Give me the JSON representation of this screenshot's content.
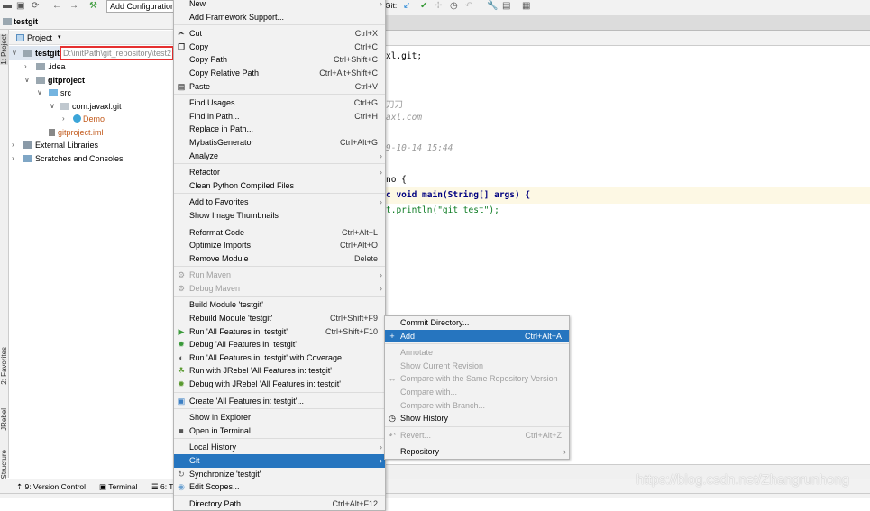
{
  "toolbar": {
    "run_config": "Add Configuration...",
    "git_label": "Git:",
    "icons": [
      "open-icon",
      "save-icon",
      "sync-icon",
      "back-icon",
      "forward-icon",
      "build-icon"
    ]
  },
  "navbar": {
    "project": "testgit"
  },
  "project_panel": {
    "title": "Project",
    "root": "testgit",
    "root_path": "D:\\initPath\\git_repository\\test2",
    "tree": [
      {
        "label": ".idea"
      },
      {
        "label": "gitproject"
      },
      {
        "label": "src"
      },
      {
        "label": "com.javaxl.git"
      },
      {
        "label": "Demo"
      },
      {
        "label": "gitproject.iml"
      },
      {
        "label": "External Libraries"
      },
      {
        "label": "Scratches and Consoles"
      }
    ]
  },
  "left_tabs": [
    "1: Project",
    "2: Favorites",
    "JRebel",
    "7: Structure"
  ],
  "code": {
    "lines": [
      "xl.git;",
      "刀刀",
      "axl.com",
      "9-10-14 15:44",
      "no {",
      "c void main(String[] args) {",
      "t.println(\"git test\");"
    ]
  },
  "bottom_tabs": [
    "9: Version Control",
    "Terminal",
    "6: T"
  ],
  "context_menu": [
    {
      "label": "New",
      "sub": true
    },
    {
      "label": "Add Framework Support..."
    },
    {
      "sep": true
    },
    {
      "label": "Cut",
      "sc": "Ctrl+X",
      "icon": "✂"
    },
    {
      "label": "Copy",
      "sc": "Ctrl+C",
      "icon": "❐"
    },
    {
      "label": "Copy Path",
      "sc": "Ctrl+Shift+C"
    },
    {
      "label": "Copy Relative Path",
      "sc": "Ctrl+Alt+Shift+C"
    },
    {
      "label": "Paste",
      "sc": "Ctrl+V",
      "icon": "▤"
    },
    {
      "sep": true
    },
    {
      "label": "Find Usages",
      "sc": "Ctrl+G"
    },
    {
      "label": "Find in Path...",
      "sc": "Ctrl+H"
    },
    {
      "label": "Replace in Path..."
    },
    {
      "label": "MybatisGenerator",
      "sc": "Ctrl+Alt+G"
    },
    {
      "label": "Analyze",
      "sub": true
    },
    {
      "sep": true
    },
    {
      "label": "Refactor",
      "sub": true
    },
    {
      "label": "Clean Python Compiled Files"
    },
    {
      "sep": true
    },
    {
      "label": "Add to Favorites",
      "sub": true
    },
    {
      "label": "Show Image Thumbnails"
    },
    {
      "sep": true
    },
    {
      "label": "Reformat Code",
      "sc": "Ctrl+Alt+L"
    },
    {
      "label": "Optimize Imports",
      "sc": "Ctrl+Alt+O"
    },
    {
      "label": "Remove Module",
      "sc": "Delete"
    },
    {
      "sep": true
    },
    {
      "label": "Run Maven",
      "sub": true,
      "dis": true,
      "icon": "⚙"
    },
    {
      "label": "Debug Maven",
      "sub": true,
      "dis": true,
      "icon": "⚙"
    },
    {
      "sep": true
    },
    {
      "label": "Build Module 'testgit'"
    },
    {
      "label": "Rebuild Module 'testgit'",
      "sc": "Ctrl+Shift+F9"
    },
    {
      "label": "Run 'All Features in: testgit'",
      "sc": "Ctrl+Shift+F10",
      "icon": "▶",
      "color": "#3a9a3a"
    },
    {
      "label": "Debug 'All Features in: testgit'",
      "icon": "✹",
      "color": "#3a9a3a"
    },
    {
      "label": "Run 'All Features in: testgit' with Coverage",
      "icon": "◐",
      "color": "#555"
    },
    {
      "label": "Run with JRebel 'All Features in: testgit'",
      "icon": "☘",
      "color": "#5a9a30"
    },
    {
      "label": "Debug with JRebel 'All Features in: testgit'",
      "icon": "✹",
      "color": "#5a9a30"
    },
    {
      "sep": true
    },
    {
      "label": "Create 'All Features in: testgit'...",
      "icon": "▣",
      "color": "#3b7fc4"
    },
    {
      "sep": true
    },
    {
      "label": "Show in Explorer"
    },
    {
      "label": "Open in Terminal",
      "icon": "■",
      "color": "#555"
    },
    {
      "sep": true
    },
    {
      "label": "Local History",
      "sub": true
    },
    {
      "label": "Git",
      "sub": true,
      "sel": true
    },
    {
      "label": "Synchronize 'testgit'",
      "icon": "↻",
      "color": "#666"
    },
    {
      "label": "Edit Scopes...",
      "icon": "◉",
      "color": "#6aa0d0"
    },
    {
      "sep": true
    },
    {
      "label": "Directory Path",
      "sc": "Ctrl+Alt+F12"
    }
  ],
  "git_submenu": [
    {
      "label": "Commit Directory..."
    },
    {
      "label": "Add",
      "sc": "Ctrl+Alt+A",
      "sel": true,
      "icon": "+"
    },
    {
      "sep": true
    },
    {
      "label": "Annotate",
      "dis": true
    },
    {
      "label": "Show Current Revision",
      "dis": true
    },
    {
      "label": "Compare with the Same Repository Version",
      "dis": true,
      "icon": "↔"
    },
    {
      "label": "Compare with...",
      "dis": true
    },
    {
      "label": "Compare with Branch...",
      "dis": true
    },
    {
      "label": "Show History",
      "icon": "◷"
    },
    {
      "sep": true
    },
    {
      "label": "Revert...",
      "sc": "Ctrl+Alt+Z",
      "dis": true,
      "icon": "↶"
    },
    {
      "sep": true
    },
    {
      "label": "Repository",
      "sub": true
    }
  ],
  "watermark": "https://blog.csdn.net/Zhangrunhong",
  "colors": {
    "selection": "#2675bf",
    "path_highlight": "#e53030",
    "menu_bg": "#f2f2f2"
  }
}
